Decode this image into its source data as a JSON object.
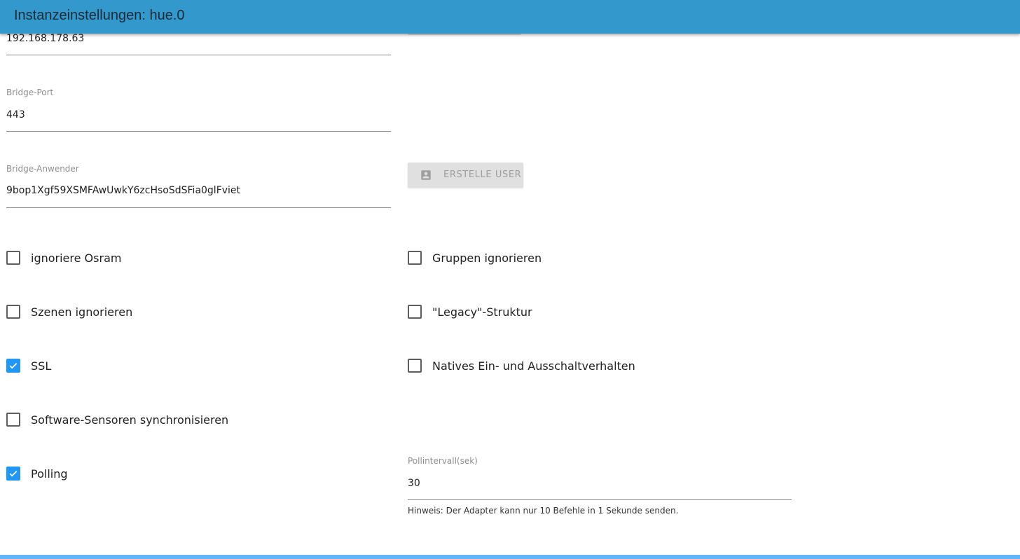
{
  "header": {
    "title": "Instanzeinstellungen: hue.0"
  },
  "fields": {
    "bridge_address": {
      "value": "192.168.178.63"
    },
    "bridge_port": {
      "label": "Bridge-Port",
      "value": "443"
    },
    "bridge_user": {
      "label": "Bridge-Anwender",
      "value": "9bop1Xgf59XSMFAwUwkY6zcHsoSdSFia0glFviet"
    },
    "poll_interval": {
      "label": "Pollintervall(sek)",
      "value": "30",
      "hint": "Hinweis: Der Adapter kann nur 10 Befehle in 1 Sekunde senden."
    }
  },
  "buttons": {
    "create_user": {
      "label": "ERSTELLE USER",
      "icon": "account-box-icon"
    }
  },
  "checkboxes": {
    "ignore_osram": {
      "label": "ignoriere Osram",
      "checked": false
    },
    "ignore_groups": {
      "label": "Gruppen ignorieren",
      "checked": false
    },
    "ignore_scenes": {
      "label": "Szenen ignorieren",
      "checked": false
    },
    "legacy_structure": {
      "label": "\"Legacy\"-Struktur",
      "checked": false
    },
    "ssl": {
      "label": "SSL",
      "checked": true
    },
    "native_turn_on_off": {
      "label": "Natives Ein- und Ausschaltverhalten",
      "checked": false
    },
    "sync_software_sensors": {
      "label": "Software-Sensoren synchronisieren",
      "checked": false
    },
    "polling": {
      "label": "Polling",
      "checked": true
    }
  },
  "colors": {
    "header": "#3399cc",
    "accent": "#2196f3",
    "bottom_bar": "#64b5f6"
  }
}
